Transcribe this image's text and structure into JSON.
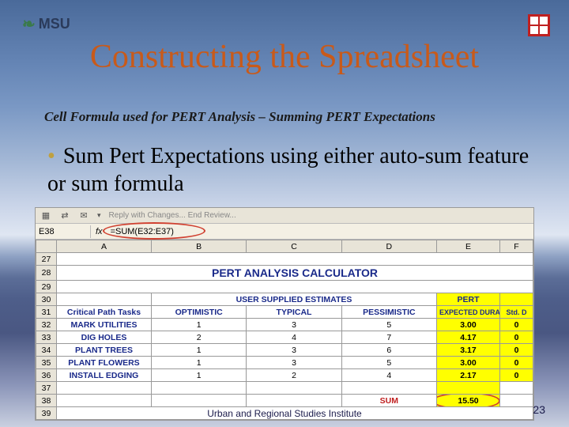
{
  "logo_text": "MSU",
  "title": "Constructing the Spreadsheet",
  "subtitle": "Cell Formula used for PERT Analysis – Summing PERT Expectations",
  "bullet": "Sum Pert Expectations using either auto-sum feature or sum formula",
  "toolbar": {
    "reply_text": "Reply with Changes... End Review..."
  },
  "formulabar": {
    "namebox": "E38",
    "fx_label": "fx",
    "formula": "=SUM(E32:E37)"
  },
  "cols": [
    "",
    "A",
    "B",
    "C",
    "D",
    "E",
    "F"
  ],
  "pert_title": "PERT ANALYSIS CALCULATOR",
  "headers1": {
    "a": "",
    "bcd": "USER SUPPLIED ESTIMATES",
    "e": "PERT",
    "f": ""
  },
  "headers2": {
    "a": "Critical Path Tasks",
    "b": "OPTIMISTIC",
    "c": "TYPICAL",
    "d": "PESSIMISTIC",
    "e": "EXPECTED DURATION",
    "f": "Std. D"
  },
  "rows": [
    {
      "n": 32,
      "task": "MARK UTILITIES",
      "o": 1,
      "t": 3,
      "p": 5,
      "exp": "3.00",
      "sd": "0"
    },
    {
      "n": 33,
      "task": "DIG HOLES",
      "o": 2,
      "t": 4,
      "p": 7,
      "exp": "4.17",
      "sd": "0"
    },
    {
      "n": 34,
      "task": "PLANT TREES",
      "o": 1,
      "t": 3,
      "p": 6,
      "exp": "3.17",
      "sd": "0"
    },
    {
      "n": 35,
      "task": "PLANT FLOWERS",
      "o": 1,
      "t": 3,
      "p": 5,
      "exp": "3.00",
      "sd": "0"
    },
    {
      "n": 36,
      "task": "INSTALL EDGING",
      "o": 1,
      "t": 2,
      "p": 4,
      "exp": "2.17",
      "sd": "0"
    }
  ],
  "rownums_extra": [
    27,
    28,
    29,
    30,
    31,
    37,
    38,
    39
  ],
  "sum": {
    "label": "SUM",
    "value": "15.50"
  },
  "footer": {
    "center": "Urban and Regional Studies Institute",
    "page": "23"
  }
}
